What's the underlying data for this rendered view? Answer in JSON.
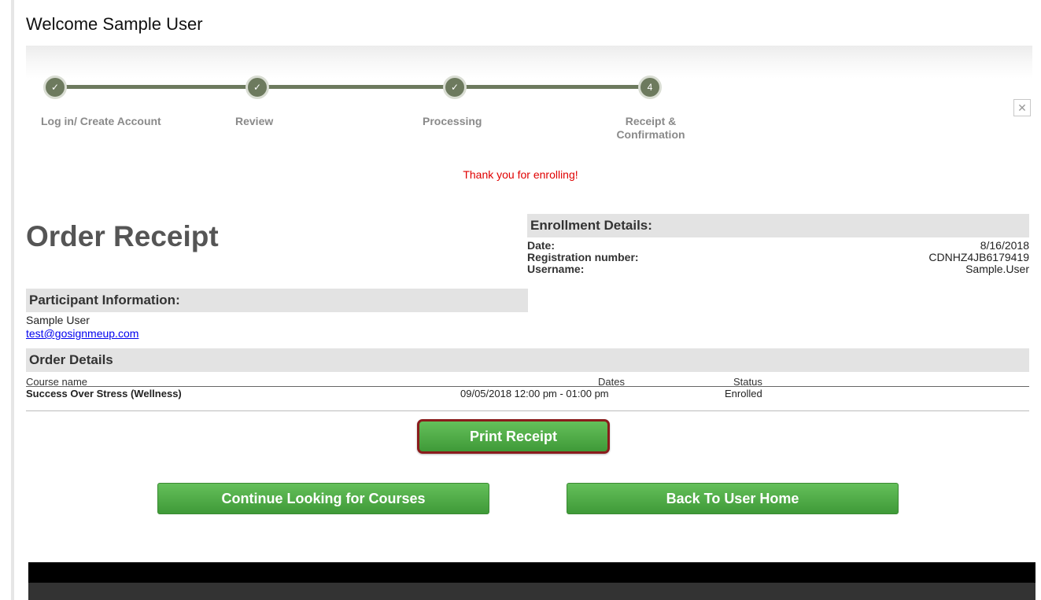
{
  "header": {
    "welcome": "Welcome Sample User"
  },
  "wizard": {
    "steps": [
      {
        "marker": "✓",
        "label": "Log in/ Create Account"
      },
      {
        "marker": "✓",
        "label": "Review"
      },
      {
        "marker": "✓",
        "label": "Processing"
      },
      {
        "marker": "4",
        "label_line1": "Receipt &",
        "label_line2": "Confirmation"
      }
    ],
    "close": "✕"
  },
  "thanks_message": "Thank you for enrolling!",
  "order_title": "Order Receipt",
  "enrollment": {
    "heading": "Enrollment Details:",
    "rows": [
      {
        "label": "Date:",
        "value": "8/16/2018"
      },
      {
        "label": "Registration number:",
        "value": "CDNHZ4JB6179419"
      },
      {
        "label": "Username:",
        "value": "Sample.User"
      }
    ]
  },
  "participant": {
    "heading": "Participant Information:",
    "name": "Sample User",
    "email": "test@gosignmeup.com"
  },
  "order_details": {
    "heading": "Order Details",
    "columns": [
      "Course name",
      "Dates",
      "Status"
    ],
    "rows": [
      {
        "course": "Success Over Stress (Wellness)",
        "dates": "09/05/2018 12:00 pm - 01:00 pm",
        "status": "Enrolled"
      }
    ]
  },
  "buttons": {
    "print": "Print Receipt",
    "continue": "Continue Looking for Courses",
    "home": "Back To User Home"
  },
  "colors": {
    "button_green": "#4caf45",
    "print_border": "#8a1c1c",
    "thanks_red": "#e00000",
    "step_green": "#6d7a5e"
  }
}
